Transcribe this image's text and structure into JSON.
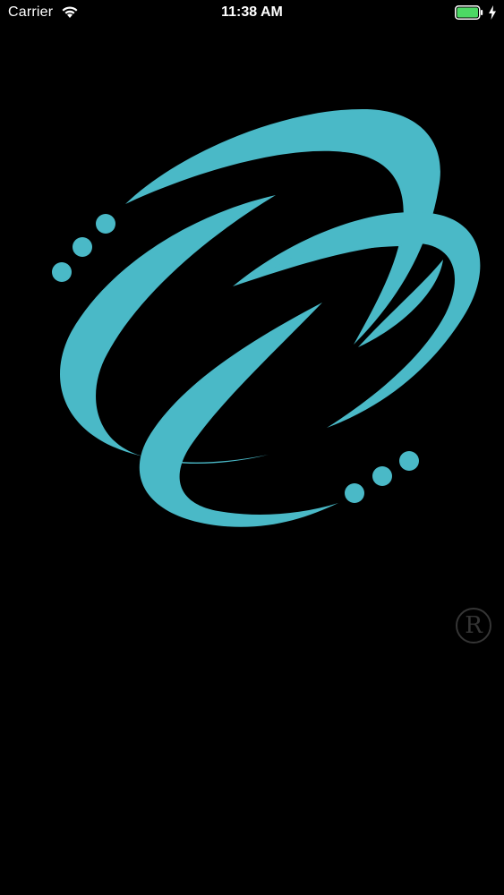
{
  "status_bar": {
    "carrier": "Carrier",
    "time": "11:38 AM",
    "wifi_icon": "wifi-icon",
    "battery_icon": "battery-icon",
    "charging_icon": "charging-bolt-icon",
    "battery_color": "#4cd964"
  },
  "splash": {
    "logo_icon": "swirl-logo-icon",
    "logo_color": "#4ab9c7",
    "registered_mark": "R",
    "registered_icon": "registered-trademark-icon",
    "registered_color": "#353535",
    "background_color": "#000000"
  }
}
